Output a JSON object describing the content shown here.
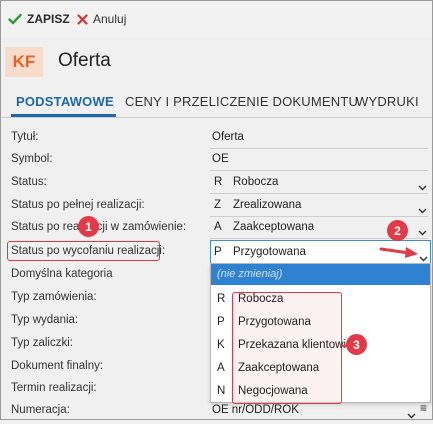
{
  "toolbar": {
    "save_label": "ZAPISZ",
    "cancel_label": "Anuluj"
  },
  "header": {
    "badge": "KF",
    "title": "Oferta"
  },
  "tabs": [
    {
      "label": "PODSTAWOWE",
      "active": true
    },
    {
      "label": "CENY I PRZELICZENIE DOKUMENTU",
      "active": false
    },
    {
      "label": "WYDRUKI",
      "active": false
    }
  ],
  "form": {
    "title": {
      "label": "Tytuł:",
      "value": "Oferta"
    },
    "symbol": {
      "label": "Symbol:",
      "value": "OE"
    },
    "status": {
      "label": "Status:",
      "code": "R",
      "text": "Robocza"
    },
    "status_full": {
      "label": "Status po pełnej realizacji:",
      "code": "Z",
      "text": "Zrealizowana"
    },
    "status_partial": {
      "label": "Status po realizacji w zamówienie:",
      "code": "A",
      "text": "Zaakceptowana"
    },
    "status_withdraw": {
      "label": "Status po wycofaniu realizacji:",
      "code": "P",
      "text": "Przygotowana"
    },
    "default_category": {
      "label": "Domyślna kategoria"
    },
    "order_type": {
      "label": "Typ zamówienia:"
    },
    "issue_type": {
      "label": "Typ wydania:"
    },
    "advance_type": {
      "label": "Typ zaliczki:"
    },
    "final_document": {
      "label": "Dokument finalny:"
    },
    "deadline": {
      "label": "Termin realizacji:"
    },
    "numbering": {
      "label": "Numeracja:",
      "value": "OE nr/ODD/ROK"
    }
  },
  "dropdown": {
    "placeholder": "(nie zmieniaj)",
    "options": [
      {
        "code": "R",
        "text": "Robocza"
      },
      {
        "code": "P",
        "text": "Przygotowana"
      },
      {
        "code": "K",
        "text": "Przekazana klientowi"
      },
      {
        "code": "A",
        "text": "Zaakceptowana"
      },
      {
        "code": "N",
        "text": "Negocjowana"
      }
    ]
  },
  "annotations": {
    "step1": "1",
    "step2": "2",
    "step3": "3"
  },
  "colors": {
    "accent": "#1e67a8",
    "highlight": "#e23a47",
    "selected": "#2f82d2",
    "badge_bg": "#f8dccb",
    "badge_fg": "#e0652b"
  }
}
